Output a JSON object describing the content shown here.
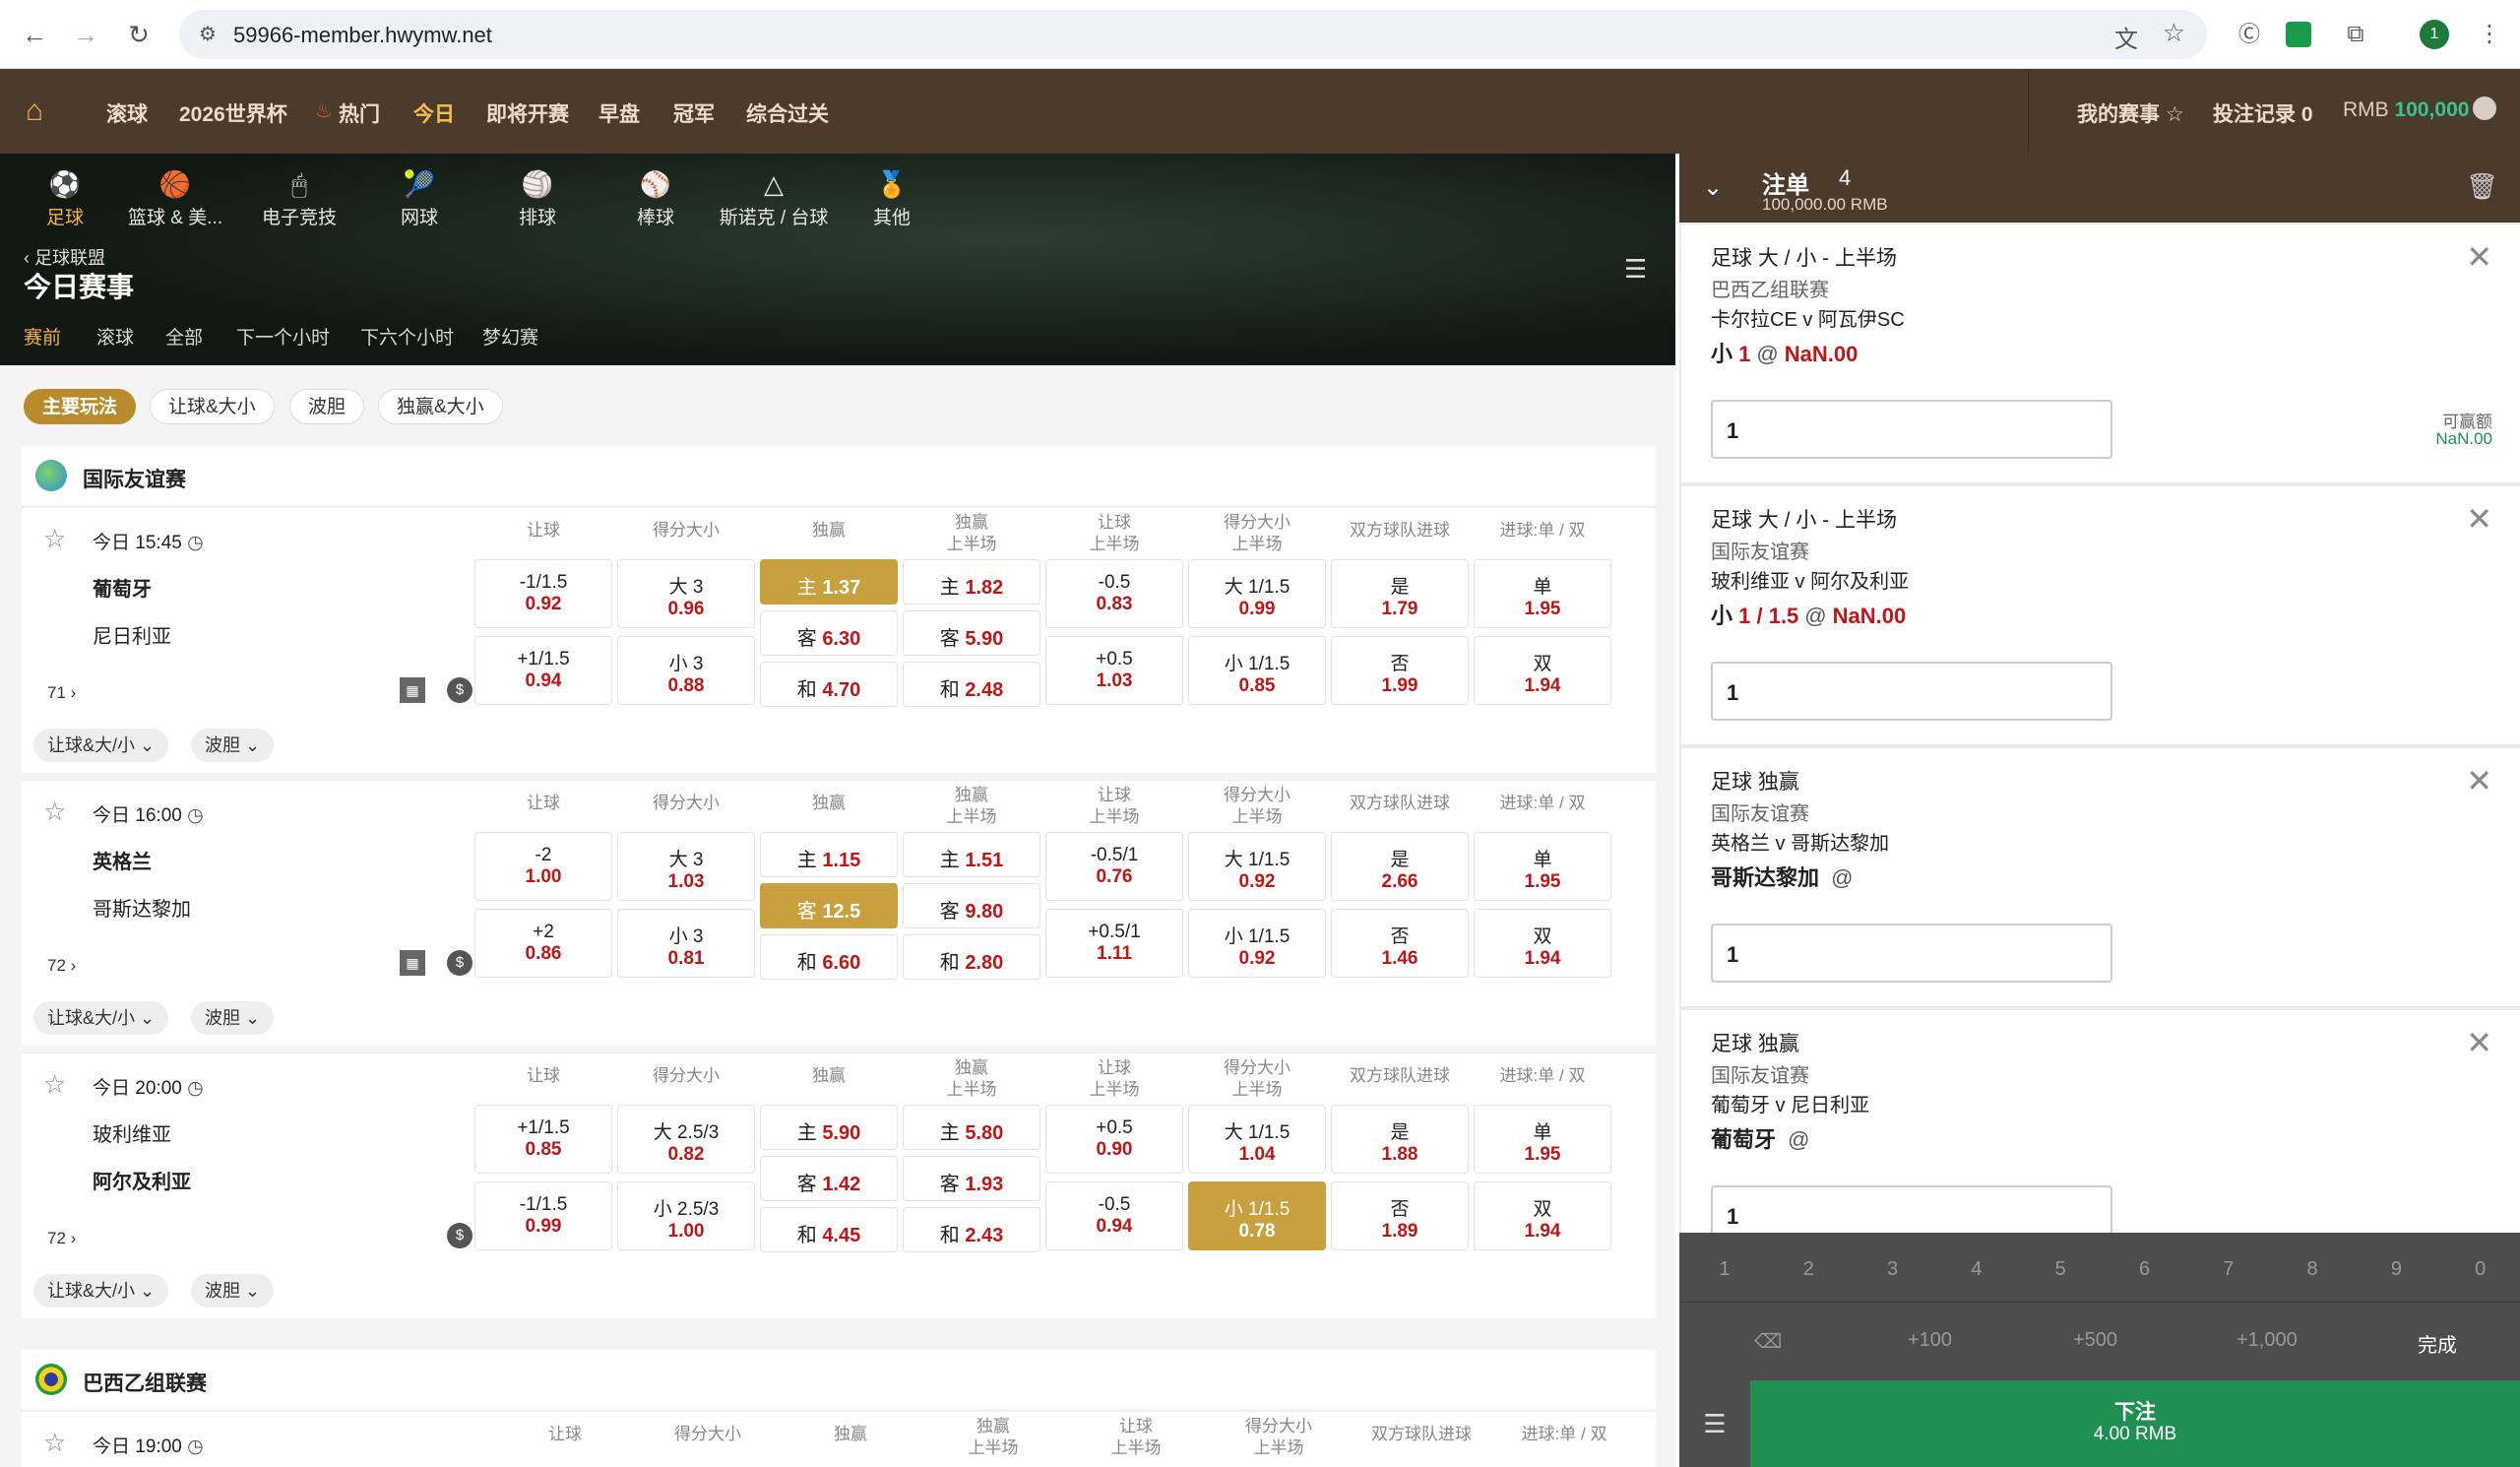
{
  "browser": {
    "url": "59966-member.hwymw.net",
    "profile_initial": "1"
  },
  "topnav": {
    "items": [
      "滚球",
      "2026世界杯",
      "热门",
      "今日",
      "即将开赛",
      "早盘",
      "冠军",
      "综合过关"
    ],
    "my_events": "我的赛事",
    "bet_record_label": "投注记录",
    "bet_record_count": "0",
    "currency": "RMB",
    "balance": "100,000"
  },
  "sports": [
    "足球",
    "篮球 & 美...",
    "电子竞技",
    "网球",
    "排球",
    "棒球",
    "斯诺克 / 台球",
    "其他"
  ],
  "hero": {
    "breadcrumb": "足球联盟",
    "title": "今日赛事",
    "tabs": [
      "赛前",
      "滚球",
      "全部",
      "下一个小时",
      "下六个小时",
      "梦幻赛"
    ]
  },
  "pills": [
    "主要玩法",
    "让球&大小",
    "波胆",
    "独赢&大小"
  ],
  "columns": [
    "让球",
    "得分大小",
    "独赢",
    "独赢\n上半场",
    "让球\n上半场",
    "得分大小\n上半场",
    "双方球队进球",
    "进球:单 / 双"
  ],
  "leagues": [
    {
      "name": "国际友谊赛",
      "flag_color": "#2a8fd8"
    },
    {
      "name": "巴西乙组联赛",
      "flag_color": "#1f9b3a"
    }
  ],
  "matches": [
    {
      "time": "今日 15:45",
      "home": "葡萄牙",
      "away": "尼日利亚",
      "count": "71",
      "row1": [
        [
          "-1/1.5",
          "0.92"
        ],
        [
          "大 3",
          "0.96"
        ],
        [
          "主",
          "1.37"
        ],
        [
          "主",
          "1.82"
        ],
        [
          "-0.5",
          "0.83"
        ],
        [
          "大 1/1.5",
          "0.99"
        ],
        [
          "是",
          "1.79"
        ],
        [
          "单",
          "1.95"
        ]
      ],
      "row2": [
        [
          "+1/1.5",
          "0.94"
        ],
        [
          "小 3",
          "0.88"
        ],
        [
          "客",
          "6.30"
        ],
        [
          "客",
          "5.90"
        ],
        [
          "+0.5",
          "1.03"
        ],
        [
          "小 1/1.5",
          "0.85"
        ],
        [
          "否",
          "1.99"
        ],
        [
          "双",
          "1.94"
        ]
      ],
      "draw": [
        [
          "和",
          "4.70"
        ],
        [
          "和",
          "2.48"
        ]
      ]
    },
    {
      "time": "今日 16:00",
      "home": "英格兰",
      "away": "哥斯达黎加",
      "count": "72",
      "row1": [
        [
          "-2",
          "1.00"
        ],
        [
          "大 3",
          "1.03"
        ],
        [
          "主",
          "1.15"
        ],
        [
          "主",
          "1.51"
        ],
        [
          "-0.5/1",
          "0.76"
        ],
        [
          "大 1/1.5",
          "0.92"
        ],
        [
          "是",
          "2.66"
        ],
        [
          "单",
          "1.95"
        ]
      ],
      "row2": [
        [
          "+2",
          "0.86"
        ],
        [
          "小 3",
          "0.81"
        ],
        [
          "客",
          "12.5"
        ],
        [
          "客",
          "9.80"
        ],
        [
          "+0.5/1",
          "1.11"
        ],
        [
          "小 1/1.5",
          "0.92"
        ],
        [
          "否",
          "1.46"
        ],
        [
          "双",
          "1.94"
        ]
      ],
      "draw": [
        [
          "和",
          "6.60"
        ],
        [
          "和",
          "2.80"
        ]
      ]
    },
    {
      "time": "今日 20:00",
      "home": "玻利维亚",
      "away": "阿尔及利亚",
      "count": "72",
      "row1": [
        [
          "+1/1.5",
          "0.85"
        ],
        [
          "大 2.5/3",
          "0.82"
        ],
        [
          "主",
          "5.90"
        ],
        [
          "主",
          "5.80"
        ],
        [
          "+0.5",
          "0.90"
        ],
        [
          "大 1/1.5",
          "1.04"
        ],
        [
          "是",
          "1.88"
        ],
        [
          "单",
          "1.95"
        ]
      ],
      "row2": [
        [
          "-1/1.5",
          "0.99"
        ],
        [
          "小 2.5/3",
          "1.00"
        ],
        [
          "客",
          "1.42"
        ],
        [
          "客",
          "1.93"
        ],
        [
          "-0.5",
          "0.94"
        ],
        [
          "小 1/1.5",
          "0.78"
        ],
        [
          "否",
          "1.89"
        ],
        [
          "双",
          "1.94"
        ]
      ],
      "draw": [
        [
          "和",
          "4.45"
        ],
        [
          "和",
          "2.43"
        ]
      ]
    },
    {
      "time": "今日 19:00"
    }
  ],
  "dropdowns": [
    "让球&大/小",
    "波胆"
  ],
  "slip": {
    "title": "注单",
    "count": "4",
    "balance": "100,000.00 RMB",
    "win_label": "可赢额",
    "win_value": "NaN.00",
    "bets": [
      {
        "type": "足球 大 / 小 - 上半场",
        "league": "巴西乙组联赛",
        "match": "卡尔拉CE v 阿瓦伊SC",
        "pick": "小",
        "line": "1",
        "odds": "NaN.00",
        "stake": "1"
      },
      {
        "type": "足球 大 / 小 - 上半场",
        "league": "国际友谊赛",
        "match": "玻利维亚 v 阿尔及利亚",
        "pick": "小",
        "line": "1 / 1.5",
        "odds": "NaN.00",
        "stake": "1"
      },
      {
        "type": "足球 独赢",
        "league": "国际友谊赛",
        "match": "英格兰 v 哥斯达黎加",
        "pick": "哥斯达黎加",
        "line": "",
        "odds": "",
        "stake": "1"
      },
      {
        "type": "足球 独赢",
        "league": "国际友谊赛",
        "match": "葡萄牙 v 尼日利亚",
        "pick": "葡萄牙",
        "line": "",
        "odds": "",
        "stake": "1"
      }
    ],
    "keys": [
      "1",
      "2",
      "3",
      "4",
      "5",
      "6",
      "7",
      "8",
      "9",
      "0"
    ],
    "quick": [
      "+100",
      "+500",
      "+1,000"
    ],
    "done": "完成",
    "submit_label": "下注",
    "submit_amount": "4.00 RMB"
  }
}
